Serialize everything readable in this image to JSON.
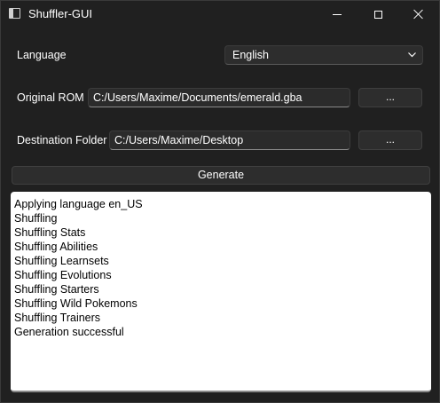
{
  "window": {
    "title": "Shuffler-GUI"
  },
  "form": {
    "language_label": "Language",
    "language_value": "English",
    "rom_label": "Original ROM",
    "rom_value": "C:/Users/Maxime/Documents/emerald.gba",
    "rom_browse_label": "...",
    "dest_label": "Destination Folder",
    "dest_value": "C:/Users/Maxime/Desktop",
    "dest_browse_label": "...",
    "generate_label": "Generate"
  },
  "log": {
    "lines": [
      "Applying language en_US",
      "Shuffling",
      "Shuffling Stats",
      "Shuffling Abilities",
      "Shuffling Learnsets",
      "Shuffling Evolutions",
      "Shuffling Starters",
      "Shuffling Wild Pokemons",
      "Shuffling Trainers",
      "Generation successful"
    ]
  },
  "icons": {
    "app": "app-window-icon",
    "minimize": "minimize-icon",
    "maximize": "maximize-icon",
    "close": "close-icon",
    "dropdown": "chevron-down-icon"
  }
}
